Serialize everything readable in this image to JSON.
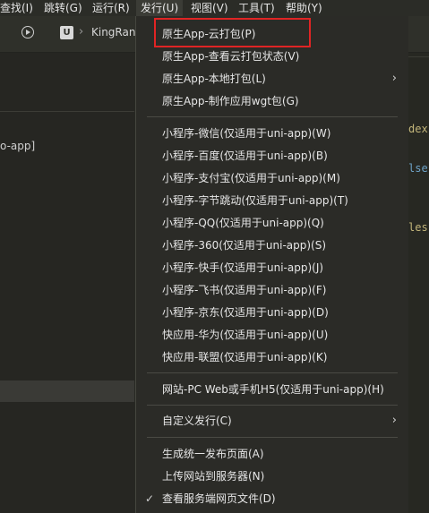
{
  "menubar": {
    "items": [
      {
        "label": "查找(I)"
      },
      {
        "label": "跳转(G)"
      },
      {
        "label": "运行(R)"
      },
      {
        "label": "发行(U)"
      },
      {
        "label": "视图(V)"
      },
      {
        "label": "工具(T)"
      },
      {
        "label": "帮助(Y)"
      }
    ]
  },
  "toolbar": {
    "badge_letter": "U",
    "breadcrumb": "KingRan"
  },
  "left_panel": {
    "project_label": "o-app]"
  },
  "editor": {
    "snippets": [
      "dex",
      "lse",
      "les"
    ]
  },
  "publish_menu": {
    "groups": [
      [
        {
          "label": "原生App-云打包(P)",
          "highlighted": true
        },
        {
          "label": "原生App-查看云打包状态(V)"
        },
        {
          "label": "原生App-本地打包(L)",
          "submenu": true
        },
        {
          "label": "原生App-制作应用wgt包(G)"
        }
      ],
      [
        {
          "label": "小程序-微信(仅适用于uni-app)(W)"
        },
        {
          "label": "小程序-百度(仅适用于uni-app)(B)"
        },
        {
          "label": "小程序-支付宝(仅适用于uni-app)(M)"
        },
        {
          "label": "小程序-字节跳动(仅适用于uni-app)(T)"
        },
        {
          "label": "小程序-QQ(仅适用于uni-app)(Q)"
        },
        {
          "label": "小程序-360(仅适用于uni-app)(S)"
        },
        {
          "label": "小程序-快手(仅适用于uni-app)(J)"
        },
        {
          "label": "小程序-飞书(仅适用于uni-app)(F)"
        },
        {
          "label": "小程序-京东(仅适用于uni-app)(D)"
        },
        {
          "label": "快应用-华为(仅适用于uni-app)(U)"
        },
        {
          "label": "快应用-联盟(仅适用于uni-app)(K)"
        }
      ],
      [
        {
          "label": "网站-PC Web或手机H5(仅适用于uni-app)(H)"
        }
      ],
      [
        {
          "label": "自定义发行(C)",
          "submenu": true
        }
      ],
      [
        {
          "label": "生成统一发布页面(A)"
        },
        {
          "label": "上传网站到服务器(N)"
        },
        {
          "label": "查看服务端网页文件(D)",
          "checked": true
        }
      ]
    ],
    "highlight_color": "#e02424"
  }
}
